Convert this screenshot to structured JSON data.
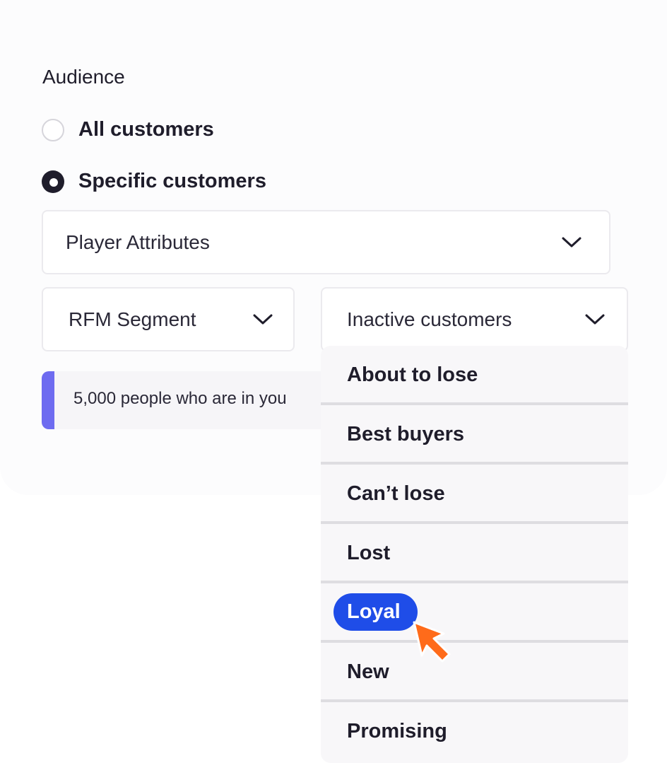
{
  "audience": {
    "heading": "Audience",
    "options": [
      {
        "label": "All customers",
        "selected": false
      },
      {
        "label": "Specific customers",
        "selected": true
      }
    ]
  },
  "filters": {
    "attribute_select": "Player Attributes",
    "segment_select": "RFM Segment",
    "value_select": "Inactive customers"
  },
  "info": {
    "text": "5,000 people who are in you",
    "accent_color": "#6e6bf0"
  },
  "dropdown": {
    "items": [
      "About to lose",
      "Best buyers",
      "Can’t lose",
      "Lost",
      "Loyal",
      "New",
      "Promising"
    ],
    "highlighted": "Loyal",
    "highlight_color": "#1f4de8"
  },
  "icons": {
    "chevron": "chevron-down-icon",
    "cursor": "mouse-pointer-icon",
    "cursor_color": "#ff6b1a"
  }
}
